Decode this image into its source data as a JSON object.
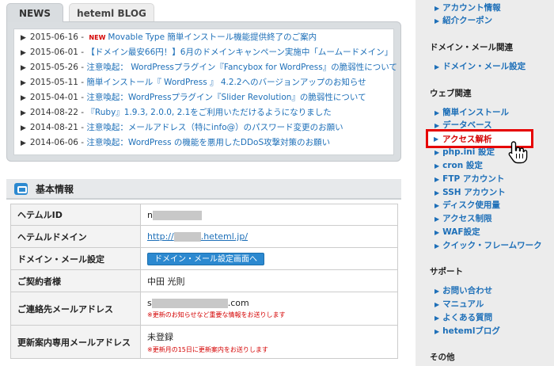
{
  "tabs": {
    "news": "NEWS",
    "blog": "heteml BLOG"
  },
  "news": [
    {
      "date": "2015-06-16",
      "new_badge": "NEW",
      "title": "Movable Type 簡単インストール機能提供終了のご案内"
    },
    {
      "date": "2015-06-01",
      "new_badge": "",
      "title": "【ドメイン最安66円！】6月のドメインキャンペーン実施中「ムームードメイン」"
    },
    {
      "date": "2015-05-26",
      "new_badge": "",
      "title": "注意喚起： WordPressプラグイン『Fancybox for WordPress』の脆弱性について"
    },
    {
      "date": "2015-05-11",
      "new_badge": "",
      "title": "簡単インストール『 WordPress 』 4.2.2へのバージョンアップのお知らせ"
    },
    {
      "date": "2015-04-01",
      "new_badge": "",
      "title": "注意喚起：WordPressプラグイン『Slider Revolution』の脆弱性について"
    },
    {
      "date": "2014-08-22",
      "new_badge": "",
      "title": "『Ruby』1.9.3, 2.0.0, 2.1をご利用いただけるようになりました"
    },
    {
      "date": "2014-08-21",
      "new_badge": "",
      "title": "注意喚起：メールアドレス（特にinfo@）のパスワード変更のお願い"
    },
    {
      "date": "2014-06-06",
      "new_badge": "",
      "title": "注意喚起：WordPress の機能を悪用したDDoS攻撃対策のお願い"
    }
  ],
  "basic_info": {
    "title": "基本情報",
    "rows": {
      "id_label": "ヘテムルID",
      "id_value": "n",
      "domain_label": "ヘテムルドメイン",
      "domain_prefix": "http://",
      "domain_suffix": ".heteml.jp/",
      "dm_label": "ドメイン・メール設定",
      "dm_button": "ドメイン・メール設定画面へ",
      "contractor_label": "ご契約者様",
      "contractor_value": "中田 光則",
      "email_label": "ご連絡先メールアドレス",
      "email_prefix": "s",
      "email_suffix": ".com",
      "email_note": "※更新のお知らせなど重要な情報をお送りします",
      "update_label": "更新案内専用メールアドレス",
      "update_value": "未登録",
      "update_note": "※更新月の15日に更新案内をお送りします"
    }
  },
  "sidebar": {
    "account_items": [
      "アカウント情報",
      "紹介クーポン"
    ],
    "domain_head": "ドメイン・メール関連",
    "domain_items": [
      "ドメイン・メール設定"
    ],
    "web_head": "ウェブ関連",
    "web_items": [
      "簡単インストール",
      "データベース",
      "アクセス解析",
      "php.ini 設定",
      "cron 設定",
      "FTP アカウント",
      "SSH アカウント",
      "ディスク使用量",
      "アクセス制限",
      "WAF設定",
      "クイック・フレームワーク"
    ],
    "support_head": "サポート",
    "support_items": [
      "お問い合わせ",
      "マニュアル",
      "よくある質問",
      "hetemlブログ"
    ],
    "other_head": "その他"
  },
  "icons": {
    "bullet": "▶",
    "side_arrow": "▶"
  },
  "colors": {
    "link": "#1d6fb8",
    "new": "#d40000",
    "highlight": "#e60000",
    "button": "#2c89d0"
  }
}
